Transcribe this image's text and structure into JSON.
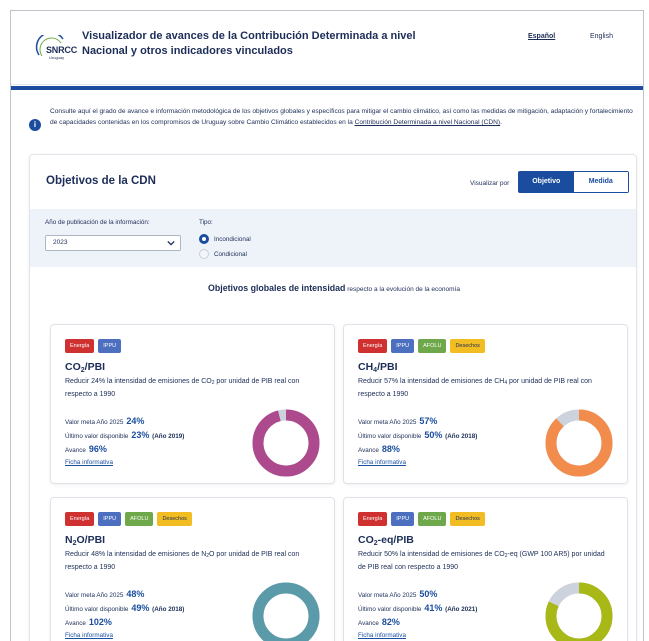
{
  "header": {
    "logo_text": "SNRCC",
    "logo_sub": "Uruguay",
    "title_line1": "Visualizador de avances de la Contribución Determinada a nivel",
    "title_line2": "Nacional y otros indicadores vinculados",
    "lang_es": "Español",
    "lang_en": "English"
  },
  "info": {
    "text_1": "Consulte aquí el grado de avance e información metodológica de los objetivos globales y específicos para mitigar el cambio climático, así como las medidas de mitigación, adaptación y fortalecimiento de capacidades contenidas en los compromisos de Uruguay sobre Cambio Climático establecidos en la ",
    "link": "Contribución Determinada a nivel Nacional (CDN)",
    "text_2": "."
  },
  "panel": {
    "title": "Objetivos de la CDN",
    "visualizar_label": "Visualizar por",
    "toggle_objetivo": "Objetivo",
    "toggle_medida": "Medida"
  },
  "filters": {
    "year_label": "Año de publicación de la información:",
    "year_value": "2023",
    "tipo_label": "Tipo:",
    "tipo_incondicional": "Incondicional",
    "tipo_condicional": "Condicional"
  },
  "section": {
    "title_bold": "Objetivos globales de intensidad",
    "title_rest": " respecto a la evolución de la economía"
  },
  "labels": {
    "meta": "Valor meta Año 2025",
    "ultimo": "Último valor disponible",
    "avance": "Avance",
    "ficha": "Ficha informativa"
  },
  "colors": {
    "primary": "#1a4d9e",
    "energia": "#cf3131",
    "ippu": "#4d6fc0",
    "afolu": "#6ea84a",
    "desechos": "#f1bd23",
    "donut_rest": "#cdd3dd"
  },
  "cards": [
    {
      "tags": [
        "Energía",
        "IPPU"
      ],
      "title_pre": "CO",
      "title_sub": "2",
      "title_post": "/PBI",
      "desc_1": "Reducir 24% la intensidad de emisiones de CO",
      "desc_sub": "2",
      "desc_2": " por unidad de PIB real con respecto a 1990",
      "meta": "24%",
      "ultimo": "23%",
      "ultimo_year": "(Año 2019)",
      "avance": "96%",
      "progress": 0.96,
      "color": "#ad4a8d"
    },
    {
      "tags": [
        "Energía",
        "IPPU",
        "AFOLU",
        "Desechos"
      ],
      "title_pre": "CH",
      "title_sub": "4",
      "title_post": "/PBI",
      "desc_1": "Reducir 57% la intensidad de emisiones de CH",
      "desc_sub": "4",
      "desc_2": " por unidad de PIB real con respecto a 1990",
      "meta": "57%",
      "ultimo": "50%",
      "ultimo_year": "(Año 2018)",
      "avance": "88%",
      "progress": 0.88,
      "color": "#f28c4d"
    },
    {
      "tags": [
        "Energía",
        "IPPU",
        "AFOLU",
        "Desechos"
      ],
      "title_pre": "N",
      "title_sub": "2",
      "title_post": "O/PBI",
      "desc_1": "Reducir 48% la intensidad de emisiones de N",
      "desc_sub": "2",
      "desc_2": "O por unidad de PIB real con respecto a 1990",
      "meta": "48%",
      "ultimo": "49%",
      "ultimo_year": "(Año 2018)",
      "avance": "102%",
      "progress": 1.0,
      "color": "#5b9aa8"
    },
    {
      "tags": [
        "Energía",
        "IPPU",
        "AFOLU",
        "Desechos"
      ],
      "title_pre": "CO",
      "title_sub": "2",
      "title_post": "-eq/PIB",
      "desc_1": "Reducir 50% la intensidad de emisiones de CO",
      "desc_sub": "2",
      "desc_2": "-eq (GWP 100 AR5) por unidad de PIB real con respecto a 1990",
      "meta": "50%",
      "ultimo": "41%",
      "ultimo_year": "(Año 2021)",
      "avance": "82%",
      "progress": 0.82,
      "color": "#a8b816"
    }
  ]
}
